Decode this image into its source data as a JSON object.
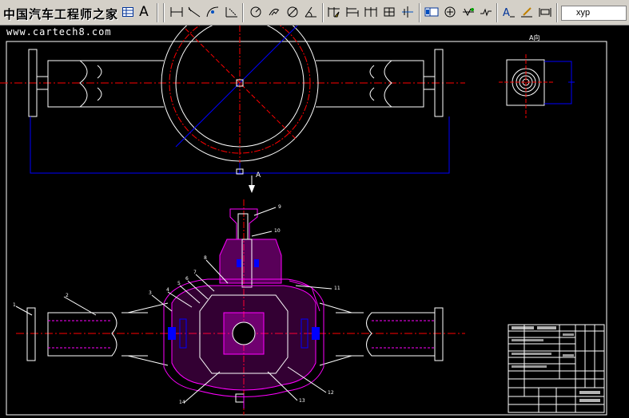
{
  "toolbar": {
    "watermark": "中国汽车工程师之家",
    "text_icon_label": "A",
    "layer_combo_value": "xyp",
    "tools": [
      "dim-linear-icon",
      "dim-aligned-icon",
      "dim-arc-icon",
      "dim-ordinate-icon",
      "dim-radius-icon",
      "dim-jogged-icon",
      "dim-diameter-icon",
      "dim-angular-icon",
      "quick-dim-icon",
      "dim-baseline-icon",
      "dim-continue-icon",
      "dim-space-icon",
      "dim-break-icon",
      "tolerance-icon",
      "center-mark-icon",
      "inspection-icon",
      "jogged-linear-icon",
      "dim-edit-icon",
      "dim-text-edit-icon",
      "dim-update-icon"
    ]
  },
  "site_url": "www.cartech8.com",
  "drawing": {
    "view_label": "A向",
    "arrow_label": "A",
    "balloon_numbers": [
      "1",
      "2",
      "3",
      "4",
      "5",
      "6",
      "7",
      "8",
      "9",
      "10",
      "11",
      "12",
      "13",
      "14"
    ]
  },
  "colors": {
    "background": "#000000",
    "outline": "#ffffff",
    "centerline": "#ff0000",
    "dimension": "#0000ff",
    "section": "#ff00ff",
    "toolbar": "#d4d0c8"
  }
}
